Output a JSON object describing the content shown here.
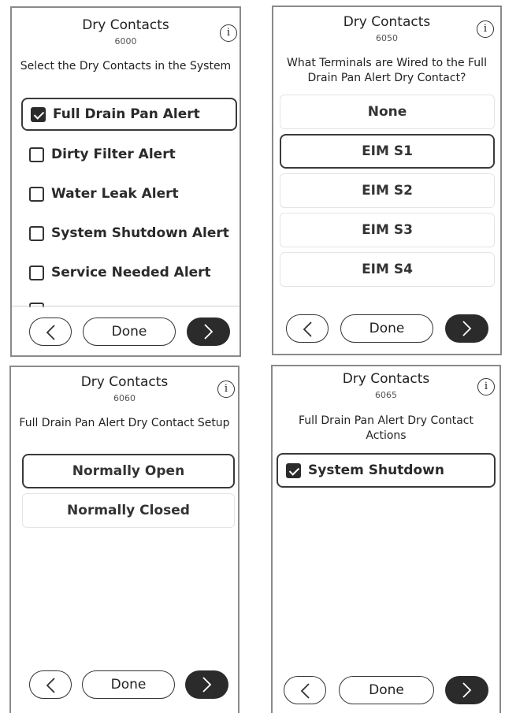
{
  "panels": [
    {
      "title": "Dry Contacts",
      "code": "6000",
      "question": "Select the Dry Contacts in the System",
      "checkboxes": [
        {
          "label": "Full Drain Pan Alert",
          "checked": true,
          "selected": true
        },
        {
          "label": "Dirty Filter Alert",
          "checked": false
        },
        {
          "label": "Water Leak Alert",
          "checked": false
        },
        {
          "label": "System Shutdown Alert",
          "checked": false
        },
        {
          "label": "Service Needed Alert",
          "checked": false
        }
      ],
      "done_label": "Done"
    },
    {
      "title": "Dry Contacts",
      "code": "6050",
      "question": "What Terminals are Wired to the Full Drain Pan Alert Dry Contact?",
      "options": [
        {
          "label": "None",
          "selected": false
        },
        {
          "label": "EIM S1",
          "selected": true
        },
        {
          "label": "EIM S2",
          "selected": false
        },
        {
          "label": "EIM S3",
          "selected": false
        },
        {
          "label": "EIM S4",
          "selected": false
        }
      ],
      "done_label": "Done"
    },
    {
      "title": "Dry Contacts",
      "code": "6060",
      "question": "Full Drain Pan Alert Dry Contact Setup",
      "options": [
        {
          "label": "Normally Open",
          "selected": true
        },
        {
          "label": "Normally Closed",
          "selected": false
        }
      ],
      "done_label": "Done"
    },
    {
      "title": "Dry Contacts",
      "code": "6065",
      "question": "Full Drain Pan Alert Dry Contact Actions",
      "checkboxes": [
        {
          "label": "System Shutdown",
          "checked": true,
          "selected": true
        }
      ],
      "done_label": "Done"
    }
  ],
  "icons": {
    "info": "i",
    "back": "chevron-left-icon",
    "next": "chevron-right-icon"
  },
  "colors": {
    "accent_dark": "#2b2b2b",
    "panel_border": "#8a8a8a",
    "selected_border": "#3a3a3a"
  }
}
